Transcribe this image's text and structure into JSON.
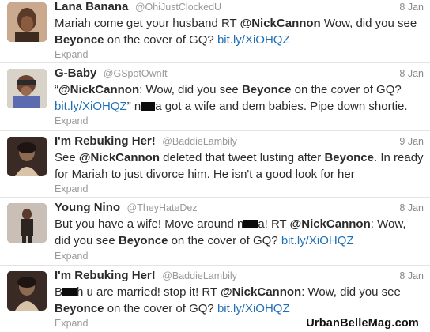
{
  "tweets": [
    {
      "name": "Lana Banana",
      "handle": "@OhiJustClockedU",
      "date": "8 Jan",
      "line1": [
        {
          "t": "Mariah come get your husband RT ",
          "k": "text"
        },
        {
          "t": "@NickCannon",
          "k": "mention"
        },
        {
          "t": " Wow, did you see",
          "k": "text"
        }
      ],
      "line2": [
        {
          "t": "Beyonce",
          "k": "bold"
        },
        {
          "t": " on the cover of GQ? ",
          "k": "text"
        },
        {
          "t": "bit.ly/XiOHQZ",
          "k": "link"
        }
      ],
      "expand": "Expand"
    },
    {
      "name": "G-Baby",
      "handle": "@GSpotOwnIt",
      "date": "8 Jan",
      "line1": [
        {
          "t": "“",
          "k": "text"
        },
        {
          "t": "@NickCannon",
          "k": "mention"
        },
        {
          "t": ": Wow, did you see ",
          "k": "text"
        },
        {
          "t": "Beyonce",
          "k": "bold"
        },
        {
          "t": " on the cover of GQ?",
          "k": "text"
        }
      ],
      "line2": [
        {
          "t": "bit.ly/XiOHQZ",
          "k": "link"
        },
        {
          "t": "” n",
          "k": "text"
        },
        {
          "t": "",
          "k": "redact"
        },
        {
          "t": "a got a wife and dem babies. Pipe down shortie.",
          "k": "text"
        }
      ],
      "expand": "Expand"
    },
    {
      "name": "I'm Rebuking Her!",
      "handle": "@BaddieLambily",
      "date": "9 Jan",
      "line1": [
        {
          "t": "See ",
          "k": "text"
        },
        {
          "t": "@NickCannon",
          "k": "mention"
        },
        {
          "t": " deleted that tweet lusting after ",
          "k": "text"
        },
        {
          "t": "Beyonce",
          "k": "bold"
        },
        {
          "t": ". In ready",
          "k": "text"
        }
      ],
      "line2": [
        {
          "t": "for Mariah to just divorce him. He isn't a good look for her",
          "k": "text"
        }
      ],
      "expand": "Expand"
    },
    {
      "name": "Young Nino",
      "handle": "@TheyHateDez",
      "date": "8 Jan",
      "line1": [
        {
          "t": "But you have a wife! Move around n",
          "k": "text"
        },
        {
          "t": "",
          "k": "redact"
        },
        {
          "t": "a! RT ",
          "k": "text"
        },
        {
          "t": "@NickCannon",
          "k": "mention"
        },
        {
          "t": ": Wow,",
          "k": "text"
        }
      ],
      "line2": [
        {
          "t": "did you see ",
          "k": "text"
        },
        {
          "t": "Beyonce",
          "k": "bold"
        },
        {
          "t": " on the cover of GQ? ",
          "k": "text"
        },
        {
          "t": "bit.ly/XiOHQZ",
          "k": "link"
        }
      ],
      "expand": "Expand"
    },
    {
      "name": "I'm Rebuking Her!",
      "handle": "@BaddieLambily",
      "date": "8 Jan",
      "line1": [
        {
          "t": "B",
          "k": "text"
        },
        {
          "t": "",
          "k": "redact"
        },
        {
          "t": "h u are married! stop it! RT ",
          "k": "text"
        },
        {
          "t": "@NickCannon",
          "k": "mention"
        },
        {
          "t": ": Wow, did you see",
          "k": "text"
        }
      ],
      "line2": [
        {
          "t": "Beyonce",
          "k": "bold"
        },
        {
          "t": " on the cover of GQ? ",
          "k": "text"
        },
        {
          "t": "bit.ly/XiOHQZ",
          "k": "link"
        }
      ],
      "expand": "Expand"
    }
  ],
  "watermark": "UrbanBelleMag.com",
  "colors": {
    "link": "#1f6fb5",
    "name": "#2b2b2b",
    "meta": "#999999",
    "divider": "#e3e3e3"
  }
}
